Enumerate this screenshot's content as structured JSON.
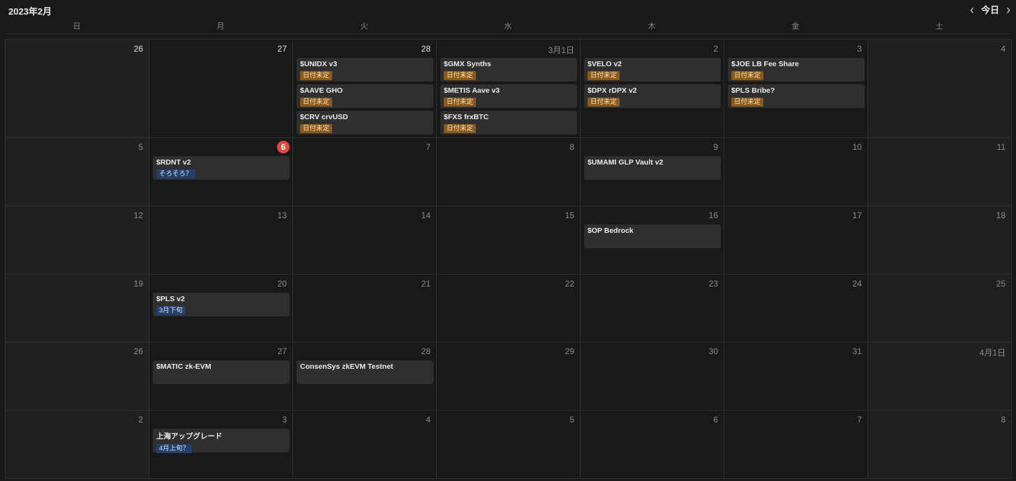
{
  "header": {
    "title": "2023年2月",
    "today_label": "今日",
    "prev_icon": "chevron-left-icon",
    "next_icon": "chevron-right-icon"
  },
  "weekdays": [
    "日",
    "月",
    "火",
    "水",
    "木",
    "金",
    "土"
  ],
  "colors": {
    "background": "#191919",
    "cell_weekend": "#202020",
    "event_bg": "#2f2f2f",
    "today_badge": "#e0483e",
    "tag_brown": "#8a5a1c",
    "tag_blue": "#24406a"
  },
  "weeks": [
    [
      {
        "day": "26",
        "current": true,
        "events": []
      },
      {
        "day": "27",
        "current": true,
        "events": []
      },
      {
        "day": "28",
        "current": true,
        "events": [
          {
            "title": "$UNIDX v3",
            "tag": "日付未定",
            "tag_color": "brown"
          },
          {
            "title": "$AAVE GHO",
            "tag": "日付未定",
            "tag_color": "brown"
          },
          {
            "title": "$CRV crvUSD",
            "tag": "日付未定",
            "tag_color": "brown"
          }
        ]
      },
      {
        "day": "3月1日",
        "events": [
          {
            "title": "$GMX Synths",
            "tag": "日付未定",
            "tag_color": "brown"
          },
          {
            "title": "$METIS Aave v3",
            "tag": "日付未定",
            "tag_color": "brown"
          },
          {
            "title": "$FXS frxBTC",
            "tag": "日付未定",
            "tag_color": "brown"
          }
        ]
      },
      {
        "day": "2",
        "events": [
          {
            "title": "$VELO v2",
            "tag": "日付未定",
            "tag_color": "brown"
          },
          {
            "title": "$DPX rDPX v2",
            "tag": "日付未定",
            "tag_color": "brown"
          }
        ]
      },
      {
        "day": "3",
        "events": [
          {
            "title": "$JOE LB Fee Share",
            "tag": "日付未定",
            "tag_color": "brown"
          },
          {
            "title": "$PLS Bribe?",
            "tag": "日付未定",
            "tag_color": "brown"
          }
        ]
      },
      {
        "day": "4",
        "events": []
      }
    ],
    [
      {
        "day": "5",
        "events": []
      },
      {
        "day": "6",
        "today": true,
        "events": [
          {
            "title": "$RDNT v2",
            "tag": "そろそろ？",
            "tag_color": "blue"
          }
        ]
      },
      {
        "day": "7",
        "events": []
      },
      {
        "day": "8",
        "events": []
      },
      {
        "day": "9",
        "events": [
          {
            "title": "$UMAMI GLP Vault v2"
          }
        ]
      },
      {
        "day": "10",
        "events": []
      },
      {
        "day": "11",
        "events": []
      }
    ],
    [
      {
        "day": "12",
        "events": []
      },
      {
        "day": "13",
        "events": []
      },
      {
        "day": "14",
        "events": []
      },
      {
        "day": "15",
        "events": []
      },
      {
        "day": "16",
        "events": [
          {
            "title": "$OP Bedrock"
          }
        ]
      },
      {
        "day": "17",
        "events": []
      },
      {
        "day": "18",
        "events": []
      }
    ],
    [
      {
        "day": "19",
        "events": []
      },
      {
        "day": "20",
        "events": [
          {
            "title": "$PLS v2",
            "tag": "3月下旬",
            "tag_color": "blue"
          }
        ]
      },
      {
        "day": "21",
        "events": []
      },
      {
        "day": "22",
        "events": []
      },
      {
        "day": "23",
        "events": []
      },
      {
        "day": "24",
        "events": []
      },
      {
        "day": "25",
        "events": []
      }
    ],
    [
      {
        "day": "26",
        "events": []
      },
      {
        "day": "27",
        "events": [
          {
            "title": "$MATIC zk-EVM"
          }
        ]
      },
      {
        "day": "28",
        "events": [
          {
            "title": "ConsenSys zkEVM Testnet"
          }
        ]
      },
      {
        "day": "29",
        "events": []
      },
      {
        "day": "30",
        "events": []
      },
      {
        "day": "31",
        "events": []
      },
      {
        "day": "4月1日",
        "events": []
      }
    ],
    [
      {
        "day": "2",
        "events": []
      },
      {
        "day": "3",
        "events": [
          {
            "title": "上海アップグレード",
            "tag": "4月上旬？",
            "tag_color": "blue"
          }
        ]
      },
      {
        "day": "4",
        "events": []
      },
      {
        "day": "5",
        "events": []
      },
      {
        "day": "6",
        "events": []
      },
      {
        "day": "7",
        "events": []
      },
      {
        "day": "8",
        "events": []
      }
    ]
  ]
}
